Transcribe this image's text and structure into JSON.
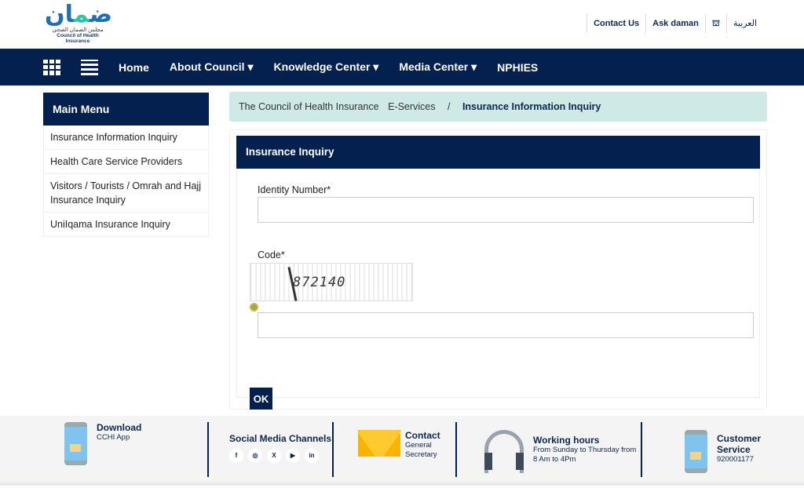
{
  "header": {
    "logo_ar": "ضمان",
    "logo_sub_ar": "مجلس الضمان الصحي",
    "logo_en": "Council of Health Insurance",
    "links": [
      "Contact Us",
      "Ask daman",
      "",
      "العربية"
    ]
  },
  "nav": {
    "items": [
      "Home",
      "About Council ▾",
      "Knowledge Center ▾",
      "Media Center ▾",
      "NPHIES"
    ]
  },
  "sidebar": {
    "title": "Main Menu",
    "items": [
      "Insurance Information Inquiry",
      "Health Care Service Providers",
      "Visitors / Tourists / Omrah and Hajj Insurance Inquiry",
      "UniIqama Insurance Inquiry"
    ]
  },
  "breadcrumb": {
    "home": "The Council of Health Insurance",
    "section": "E-Services",
    "sep": "/",
    "current": "Insurance Information Inquiry"
  },
  "form": {
    "title": "Insurance Inquiry",
    "identity_label": "Identity Number*",
    "identity_value": "",
    "code_label": "Code*",
    "captcha": "872140",
    "code_value": "",
    "submit": "OK"
  },
  "footer": {
    "download_title": "Download",
    "download_sub": "CCHI App",
    "social_title": "Social Media Channels",
    "social": [
      "f",
      "◎",
      "X",
      "▶",
      "in"
    ],
    "contact_title": "Contact",
    "contact_sub1": "General",
    "contact_sub2": "Secretary",
    "hours_title": "Working hours",
    "hours_sub1": "From Sunday to Thursday from",
    "hours_sub2": "8 Am to 4Pm",
    "cs_title1": "Customer",
    "cs_title2": "Service",
    "cs_number": "920001177"
  },
  "colors": {
    "navy": "#03204f",
    "breadcrumb_bg": "#cfe9e6"
  }
}
